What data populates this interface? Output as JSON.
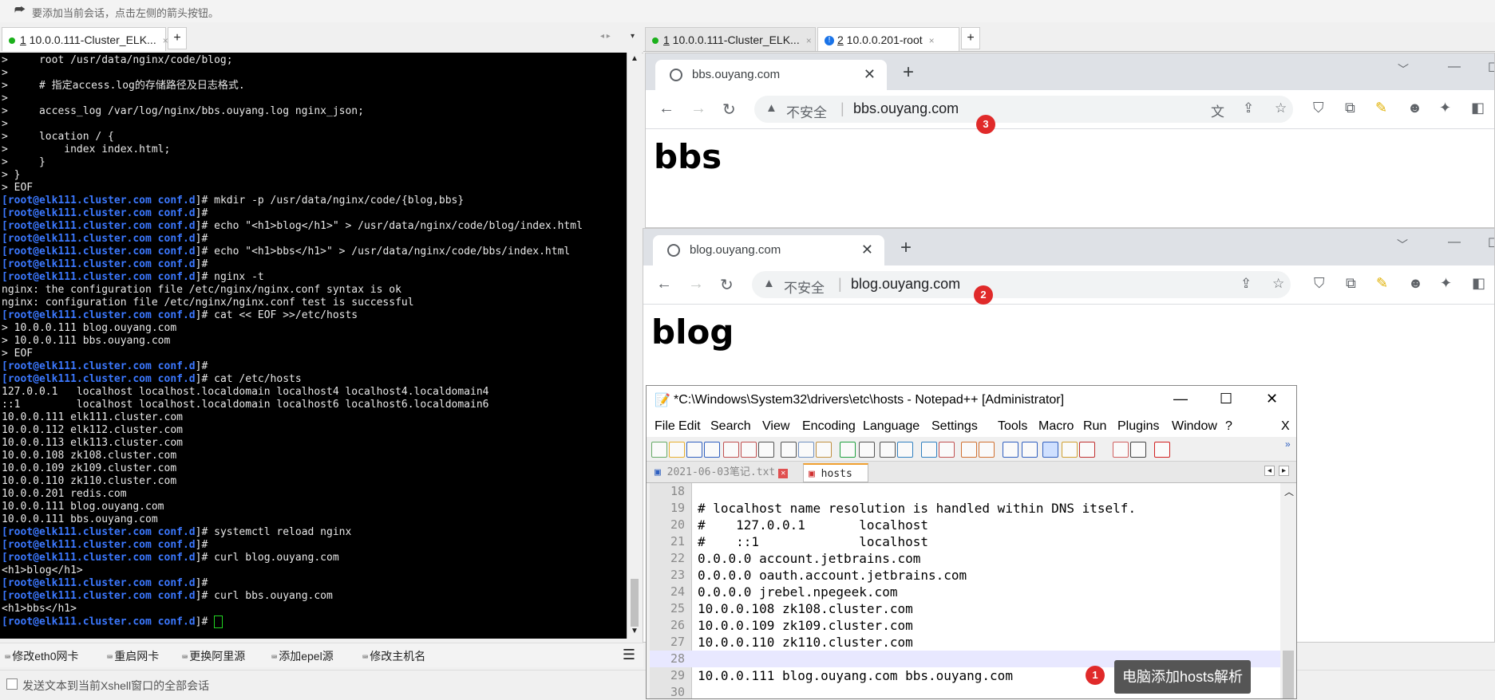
{
  "hint": {
    "text": "要添加当前会话，点击左侧的箭头按钮。"
  },
  "left_tabs": {
    "active": {
      "index": "1",
      "label": " 10.0.0.111-Cluster_ELK...",
      "close": "×"
    },
    "add": "+"
  },
  "terminal": {
    "prompt": "[root@elk111.cluster.com ",
    "cwd": "conf.d",
    "prompt_end": "]# ",
    "lines": [
      {
        "t": "o",
        "s": ">     root /usr/data/nginx/code/blog;"
      },
      {
        "t": "o",
        "s": ">"
      },
      {
        "t": "o",
        "s": ">     # 指定access.log的存储路径及日志格式."
      },
      {
        "t": "o",
        "s": ">"
      },
      {
        "t": "o",
        "s": ">     access_log /var/log/nginx/bbs.ouyang.log nginx_json;"
      },
      {
        "t": "o",
        "s": ">"
      },
      {
        "t": "o",
        "s": ">     location / {"
      },
      {
        "t": "o",
        "s": ">         index index.html;"
      },
      {
        "t": "o",
        "s": ">     }"
      },
      {
        "t": "o",
        "s": "> }"
      },
      {
        "t": "o",
        "s": "> EOF"
      },
      {
        "t": "p",
        "s": "mkdir -p /usr/data/nginx/code/{blog,bbs}"
      },
      {
        "t": "p",
        "s": ""
      },
      {
        "t": "p",
        "s": "echo \"<h1>blog</h1>\" > /usr/data/nginx/code/blog/index.html"
      },
      {
        "t": "p",
        "s": ""
      },
      {
        "t": "p",
        "s": "echo \"<h1>bbs</h1>\" > /usr/data/nginx/code/bbs/index.html"
      },
      {
        "t": "p",
        "s": ""
      },
      {
        "t": "p",
        "s": "nginx -t"
      },
      {
        "t": "o",
        "s": "nginx: the configuration file /etc/nginx/nginx.conf syntax is ok"
      },
      {
        "t": "o",
        "s": "nginx: configuration file /etc/nginx/nginx.conf test is successful"
      },
      {
        "t": "p",
        "s": "cat << EOF >>/etc/hosts"
      },
      {
        "t": "o",
        "s": "> 10.0.0.111 blog.ouyang.com"
      },
      {
        "t": "o",
        "s": "> 10.0.0.111 bbs.ouyang.com"
      },
      {
        "t": "o",
        "s": "> EOF"
      },
      {
        "t": "p",
        "s": ""
      },
      {
        "t": "p",
        "s": "cat /etc/hosts"
      },
      {
        "t": "o",
        "s": "127.0.0.1   localhost localhost.localdomain localhost4 localhost4.localdomain4"
      },
      {
        "t": "o",
        "s": "::1         localhost localhost.localdomain localhost6 localhost6.localdomain6"
      },
      {
        "t": "o",
        "s": "10.0.0.111 elk111.cluster.com"
      },
      {
        "t": "o",
        "s": "10.0.0.112 elk112.cluster.com"
      },
      {
        "t": "o",
        "s": "10.0.0.113 elk113.cluster.com"
      },
      {
        "t": "o",
        "s": "10.0.0.108 zk108.cluster.com"
      },
      {
        "t": "o",
        "s": "10.0.0.109 zk109.cluster.com"
      },
      {
        "t": "o",
        "s": "10.0.0.110 zk110.cluster.com"
      },
      {
        "t": "o",
        "s": "10.0.0.201 redis.com"
      },
      {
        "t": "o",
        "s": "10.0.0.111 blog.ouyang.com"
      },
      {
        "t": "o",
        "s": "10.0.0.111 bbs.ouyang.com"
      },
      {
        "t": "p",
        "s": "systemctl reload nginx"
      },
      {
        "t": "p",
        "s": ""
      },
      {
        "t": "p",
        "s": "curl blog.ouyang.com"
      },
      {
        "t": "o",
        "s": "<h1>blog</h1>"
      },
      {
        "t": "p",
        "s": ""
      },
      {
        "t": "p",
        "s": "curl bbs.ouyang.com"
      },
      {
        "t": "o",
        "s": "<h1>bbs</h1>"
      },
      {
        "t": "c",
        "s": ""
      }
    ]
  },
  "quick_commands": [
    "修改eth0网卡",
    "重启网卡",
    "更换阿里源",
    "添加epel源",
    "修改主机名"
  ],
  "status_bar": {
    "text": "发送文本到当前Xshell窗口的全部会话"
  },
  "right_tabs": {
    "tab1": {
      "index": "1",
      "label": " 10.0.0.111-Cluster_ELK...",
      "close": "×"
    },
    "tab2": {
      "index": "2",
      "label": " 10.0.0.201-root",
      "close": "×"
    },
    "add": "+"
  },
  "browser_bbs": {
    "tab_title": "bbs.ouyang.com",
    "not_secure": "不安全",
    "url": "bbs.ouyang.com",
    "heading": "bbs",
    "badge": "3"
  },
  "browser_blog": {
    "tab_title": "blog.ouyang.com",
    "not_secure": "不安全",
    "url": "blog.ouyang.com",
    "heading": "blog",
    "badge": "2"
  },
  "notepad": {
    "title": "*C:\\Windows\\System32\\drivers\\etc\\hosts - Notepad++ [Administrator]",
    "menu": [
      "File",
      "Edit",
      "Search",
      "View",
      "Encoding",
      "Language",
      "Settings",
      "Tools",
      "Macro",
      "Run",
      "Plugins",
      "Window",
      "?"
    ],
    "menu_close": "X",
    "file_tabs": [
      {
        "label": "2021-06-03笔记.txt",
        "active": false
      },
      {
        "label": "hosts",
        "active": true
      }
    ],
    "lines": [
      {
        "n": "18",
        "s": ""
      },
      {
        "n": "19",
        "s": "# localhost name resolution is handled within DNS itself."
      },
      {
        "n": "20",
        "s": "#    127.0.0.1       localhost"
      },
      {
        "n": "21",
        "s": "#    ::1             localhost"
      },
      {
        "n": "22",
        "s": "0.0.0.0 account.jetbrains.com"
      },
      {
        "n": "23",
        "s": "0.0.0.0 oauth.account.jetbrains.com"
      },
      {
        "n": "24",
        "s": "0.0.0.0 jrebel.npegeek.com"
      },
      {
        "n": "25",
        "s": "10.0.0.108 zk108.cluster.com"
      },
      {
        "n": "26",
        "s": "10.0.0.109 zk109.cluster.com"
      },
      {
        "n": "27",
        "s": "10.0.0.110 zk110.cluster.com"
      },
      {
        "n": "28",
        "s": ""
      },
      {
        "n": "29",
        "s": "10.0.0.111 blog.ouyang.com bbs.ouyang.com"
      },
      {
        "n": "30",
        "s": ""
      }
    ],
    "badge": "1",
    "annotation": "电脑添加hosts解析"
  },
  "colors": {
    "terminal_bg": "#000000",
    "prompt_blue": "#3b78ff",
    "badge_red": "#e02a2a",
    "tooltip_bg": "#555555"
  }
}
